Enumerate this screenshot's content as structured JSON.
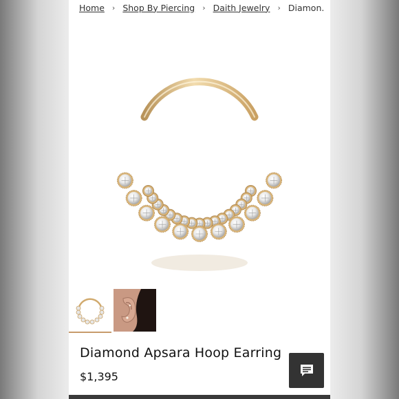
{
  "breadcrumb": {
    "items": [
      "Home",
      "Shop By Piercing",
      "Daith Jewelry"
    ],
    "current": "Diamon...",
    "separator": "›"
  },
  "product": {
    "title": "Diamond Apsara Hoop Earring",
    "price": "$1,395"
  },
  "gallery": {
    "thumbnails": [
      "product-thumb",
      "ear-model-thumb"
    ],
    "selected_index": 0
  },
  "chat": {
    "icon": "chat-icon"
  },
  "colors": {
    "gold": "#d9b57a",
    "accent_underline": "#c79b6b",
    "chat_bg": "#333333"
  }
}
